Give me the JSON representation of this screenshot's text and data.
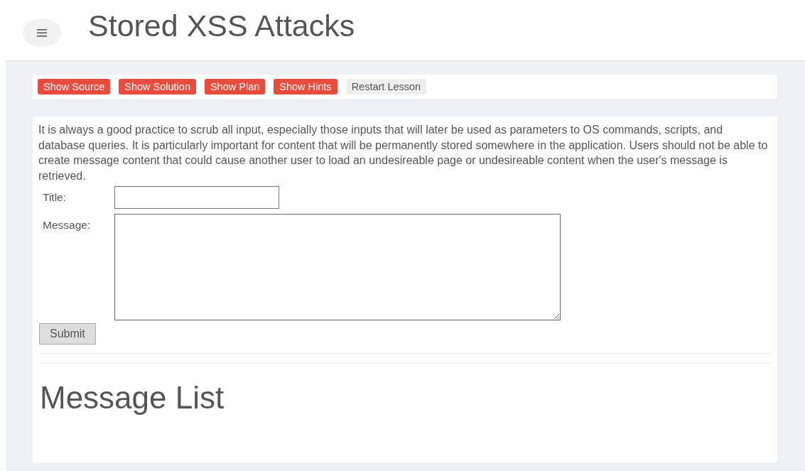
{
  "header": {
    "title": "Stored XSS Attacks"
  },
  "lesson_buttons": [
    {
      "label": "Show Source",
      "kind": "primary"
    },
    {
      "label": "Show Solution",
      "kind": "primary"
    },
    {
      "label": "Show Plan",
      "kind": "primary"
    },
    {
      "label": "Show Hints",
      "kind": "primary"
    },
    {
      "label": "Restart Lesson",
      "kind": "plain"
    }
  ],
  "description": "It is always a good practice to scrub all input, especially those inputs that will later be used as parameters to OS commands, scripts, and database queries. It is particularly important for content that will be permanently stored somewhere in the application. Users should not be able to create message content that could cause another user to load an undesireable page or undesireable content when the user's message is retrieved.",
  "form": {
    "title_label": "Title:",
    "message_label": "Message:",
    "submit": "Submit"
  },
  "message_list": {
    "heading": "Message List"
  }
}
